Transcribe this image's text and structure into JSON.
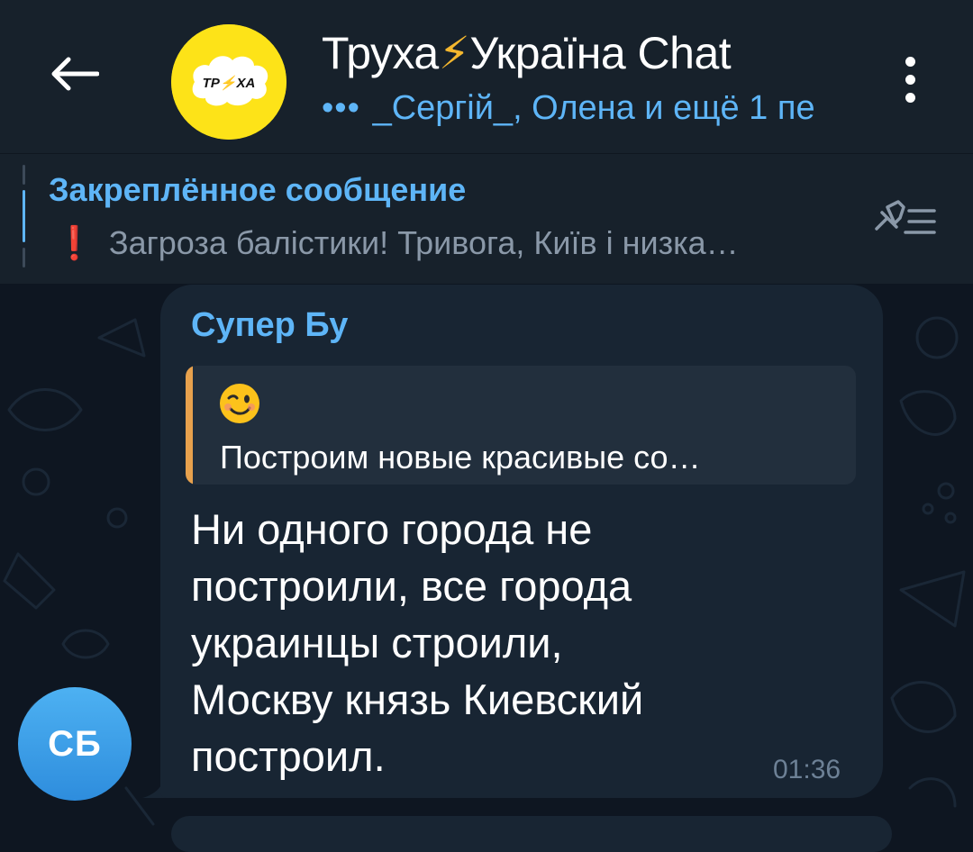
{
  "header": {
    "title_part1": "Труха",
    "title_bolt": "⚡",
    "title_part2": "Україна Chat",
    "typing_indicator": "•••",
    "subtitle": "_Сергій_, Олена и ещё 1 пе",
    "avatar_logo_text": "ТР⚡ХА"
  },
  "pinned": {
    "label": "Закреплённое сообщение",
    "text": "Загроза балістики! Тривога, Київ і низка…",
    "exclam": "❗"
  },
  "message": {
    "sender_name": "Супер Бу",
    "sender_initials": "СБ",
    "reply_emoji": "😉",
    "reply_text": "Построим новые красивые со…",
    "lines": [
      "Ни одного города не",
      "построили, все города",
      "украинцы строили,",
      "Москву князь Киевский",
      "построил."
    ],
    "time": "01:36"
  },
  "colors": {
    "header_bg": "#17212b",
    "chat_bg": "#0e1621",
    "bubble_bg": "#182533",
    "accent": "#5eb5f7",
    "reply_bar": "#e7a14d",
    "avatar_yellow": "#fde318"
  },
  "icons": {
    "back": "arrow-left-icon",
    "menu": "vertical-dots-icon",
    "unpin": "unpin-list-icon",
    "alert": "exclamation-icon"
  }
}
